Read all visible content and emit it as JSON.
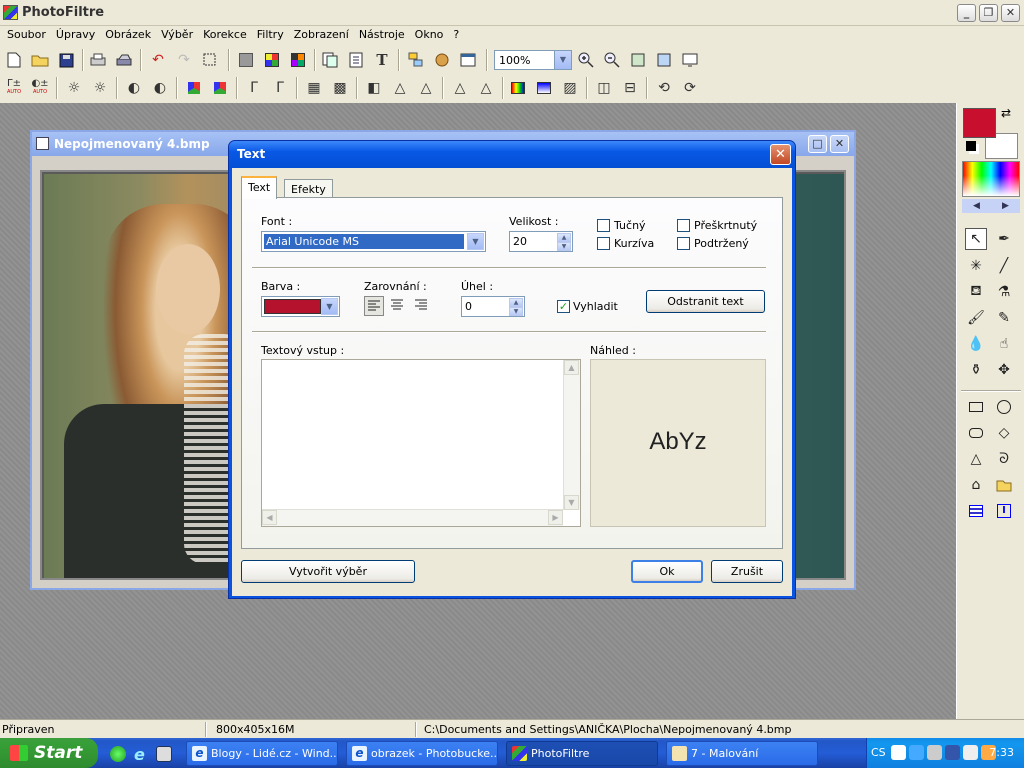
{
  "app": {
    "title": "PhotoFiltre"
  },
  "menu": [
    "Soubor",
    "Úpravy",
    "Obrázek",
    "Výběr",
    "Korekce",
    "Filtry",
    "Zobrazení",
    "Nástroje",
    "Okno",
    "?"
  ],
  "toolbar1": {
    "zoom_value": "100%"
  },
  "toolbar2": {
    "auto_label_1": "AUTO",
    "auto_label_2": "AUTO"
  },
  "document": {
    "title": "Nepojmenovaný 4.bmp"
  },
  "dialog": {
    "title": "Text",
    "tabs": [
      "Text",
      "Efekty"
    ],
    "font_label": "Font :",
    "font_value": "Arial Unicode MS",
    "size_label": "Velikost :",
    "size_value": "20",
    "checkboxes": [
      {
        "label": "Tučný",
        "checked": false
      },
      {
        "label": "Kurzíva",
        "checked": false
      },
      {
        "label": "Přeškrtnutý",
        "checked": false
      },
      {
        "label": "Podtržený",
        "checked": false
      }
    ],
    "color_label": "Barva :",
    "color_value": "#b5122e",
    "align_label": "Zarovnání :",
    "angle_label": "Úhel :",
    "angle_value": "0",
    "smooth_label": "Vyhladit",
    "smooth_checked": true,
    "remove_text_button": "Odstranit text",
    "text_input_label": "Textový vstup :",
    "preview_label": "Náhled :",
    "preview_text": "AbYz",
    "create_selection_button": "Vytvořit výběr",
    "ok_button": "Ok",
    "cancel_button": "Zrušit"
  },
  "palette": {
    "foreground_color": "#c8102e",
    "background_color": "#ffffff"
  },
  "statusbar": {
    "status": "Připraven",
    "image_info": "800x405x16M",
    "path": "C:\\Documents and Settings\\ANIČKA\\Plocha\\Nepojmenovaný 4.bmp"
  },
  "taskbar": {
    "start_label": "Start",
    "tasks": [
      {
        "label": "Blogy - Lidé.cz - Wind...",
        "active": false
      },
      {
        "label": "obrazek - Photobucke...",
        "active": false
      },
      {
        "label": "PhotoFiltre",
        "active": true
      },
      {
        "label": "7 - Malování",
        "active": false
      }
    ],
    "language": "CS",
    "clock": "7:33"
  }
}
